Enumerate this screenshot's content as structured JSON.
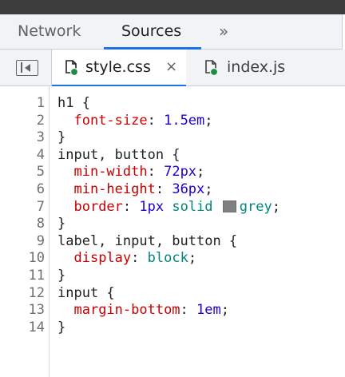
{
  "panel_tabs": {
    "network_label": "Network",
    "sources_label": "Sources",
    "more_label": "»"
  },
  "file_tabs": {
    "active": {
      "label": "style.css",
      "close_label": "×",
      "icon": "css-file-icon"
    },
    "inactive": {
      "label": "index.js",
      "icon": "js-file-icon"
    }
  },
  "colors": {
    "accent": "#1a73e8",
    "property": "#c80000",
    "number": "#1c00cf",
    "keyword": "#00867d",
    "swatch_grey": "#808080",
    "file_status_dot": "#1e8e3e"
  },
  "code": {
    "lines": [
      {
        "n": "1",
        "selector": "h1 {"
      },
      {
        "n": "2",
        "prop": "font-size",
        "num": "1.5em"
      },
      {
        "n": "3",
        "text": "}"
      },
      {
        "n": "4",
        "selector": "input, button {"
      },
      {
        "n": "5",
        "prop": "min-width",
        "num": "72px"
      },
      {
        "n": "6",
        "prop": "min-height",
        "num": "36px"
      },
      {
        "n": "7",
        "prop": "border",
        "num": "1px",
        "kw": "solid",
        "color": "grey"
      },
      {
        "n": "8",
        "text": "}"
      },
      {
        "n": "9",
        "selector": "label, input, button {"
      },
      {
        "n": "10",
        "prop": "display",
        "kw": "block"
      },
      {
        "n": "11",
        "text": "}"
      },
      {
        "n": "12",
        "selector": "input {"
      },
      {
        "n": "13",
        "prop": "margin-bottom",
        "num": "1em"
      },
      {
        "n": "14",
        "text": "}"
      }
    ],
    "colon": ": ",
    "semicolon": ";",
    "indent": "  "
  }
}
